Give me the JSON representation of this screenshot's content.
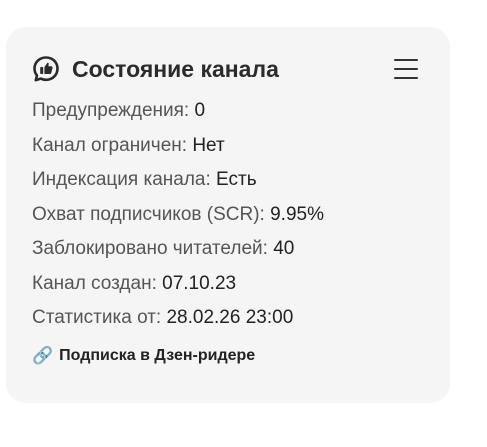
{
  "card": {
    "title": "Состояние канала",
    "title_icon": "thumbs-up-chat-icon",
    "menu_icon": "hamburger-menu-icon"
  },
  "stats": [
    {
      "label": "Предупреждения: ",
      "value": "0"
    },
    {
      "label": "Канал ограничен: ",
      "value": "Нет"
    },
    {
      "label": "Индексация канала: ",
      "value": "Есть"
    },
    {
      "label": "Охват подписчиков (SCR): ",
      "value": "9.95%"
    },
    {
      "label": "Заблокировано читателей: ",
      "value": "40"
    },
    {
      "label": "Канал создан: ",
      "value": "07.10.23"
    },
    {
      "label": "Статистика от: ",
      "value": "28.02.26 23:00"
    }
  ],
  "link": {
    "icon": "🔗",
    "label": "Подписка в Дзен-ридере"
  },
  "colors": {
    "card_background": "#f5f5f5",
    "text_primary": "#222222",
    "text_label": "#555555"
  }
}
